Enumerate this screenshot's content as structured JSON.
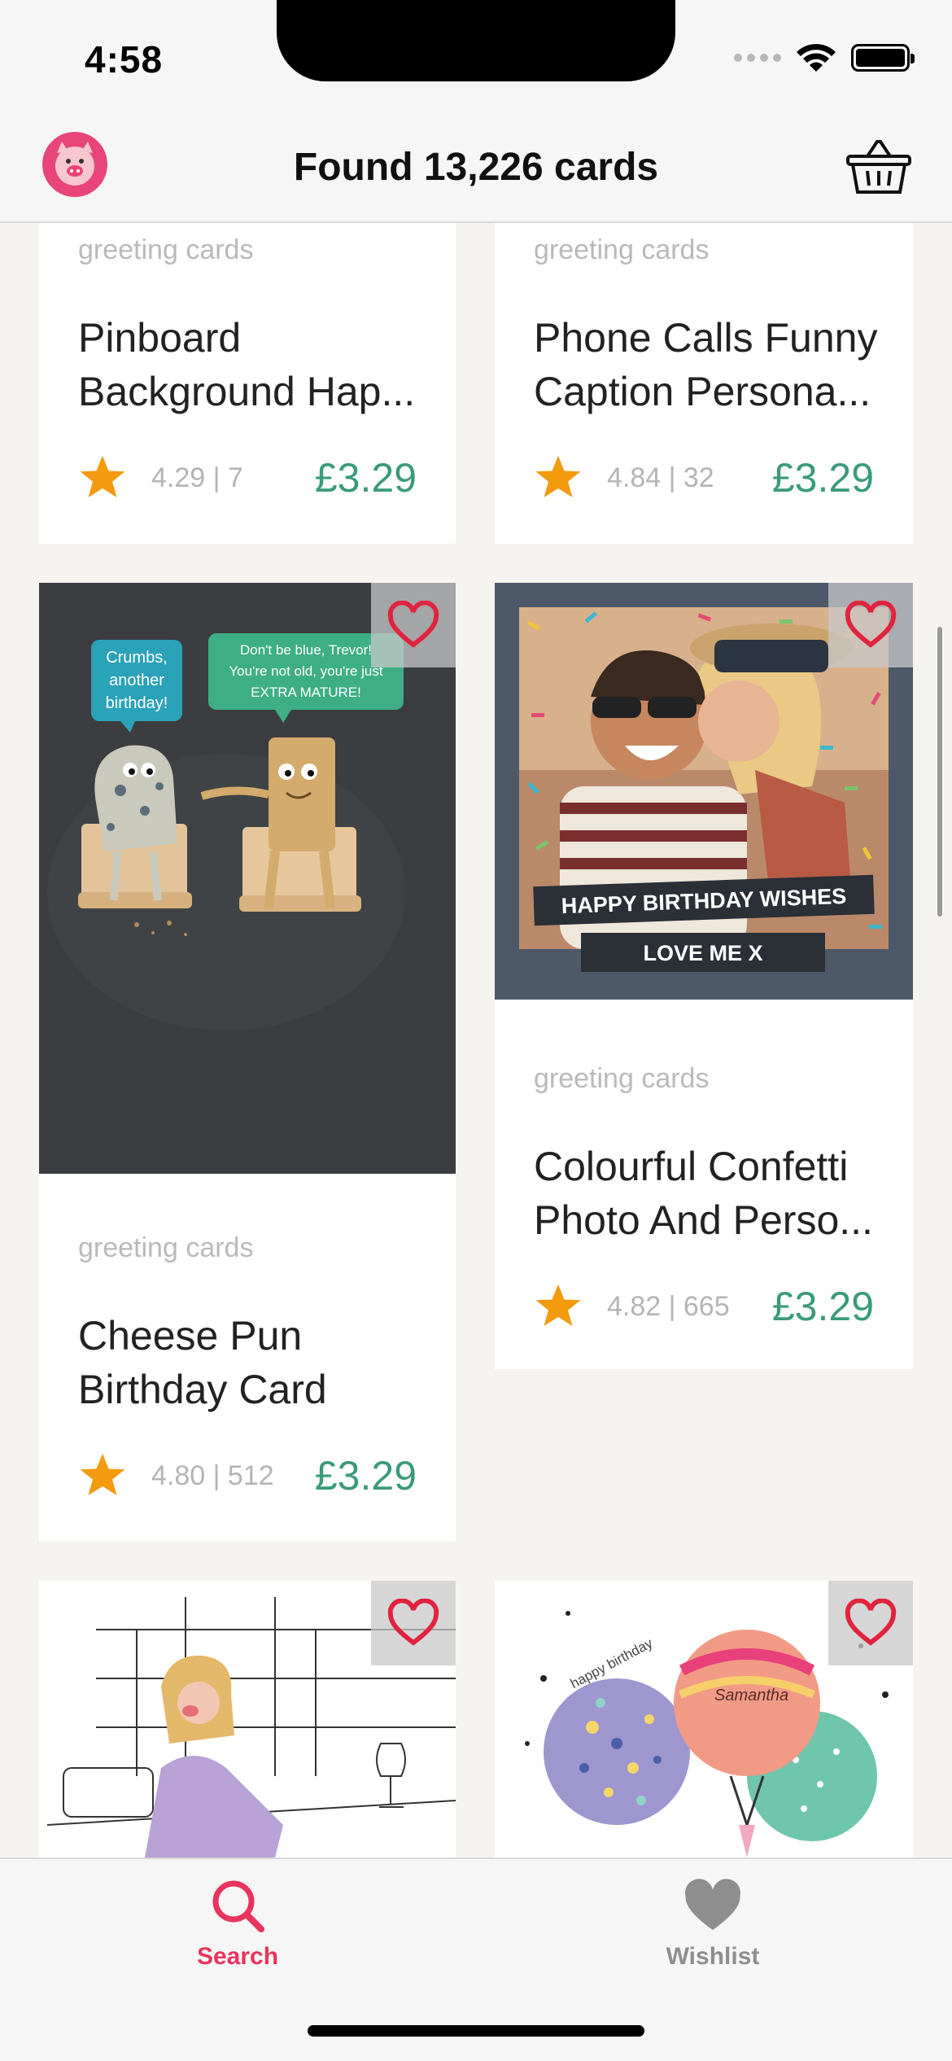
{
  "status_bar": {
    "time": "4:58"
  },
  "header": {
    "title": "Found 13,226 cards",
    "logo_icon": "pig-logo-icon",
    "basket_icon": "basket-icon"
  },
  "cards": [
    {
      "category": "greeting cards",
      "title": "Pinboard\nBackground Hap...",
      "rating": "4.29 | 7",
      "price": "£3.29"
    },
    {
      "category": "greeting cards",
      "title": "Phone Calls Funny\nCaption Persona...",
      "rating": "4.84 | 32",
      "price": "£3.29"
    },
    {
      "category": "greeting cards",
      "title": "Cheese Pun\nBirthday Card",
      "rating": "4.80 | 512",
      "price": "£3.29",
      "image": {
        "bubble_left": "Crumbs,\nanother\nbirthday!",
        "bubble_right": "Don't be blue, Trevor!\nYou're not old, you're just\nEXTRA MATURE!"
      }
    },
    {
      "category": "greeting cards",
      "title": "Colourful Confetti\nPhoto And Perso...",
      "rating": "4.82 | 665",
      "price": "£3.29",
      "image": {
        "banner_1": "HAPPY BIRTHDAY WISHES",
        "banner_2": "LOVE ME X"
      }
    },
    {
      "image": {
        "caption": ""
      }
    },
    {
      "image": {
        "text_1": "happy birthday",
        "text_2": "Samantha"
      }
    }
  ],
  "tabs": [
    {
      "label": "Search",
      "icon": "search-icon",
      "active": true
    },
    {
      "label": "Wishlist",
      "icon": "heart-icon",
      "active": false
    }
  ],
  "colors": {
    "accent": "#e8345e",
    "price": "#3a9a7c",
    "star": "#f39a0f",
    "heart": "#e0243e",
    "inactive_tab": "#8e8e8e"
  }
}
